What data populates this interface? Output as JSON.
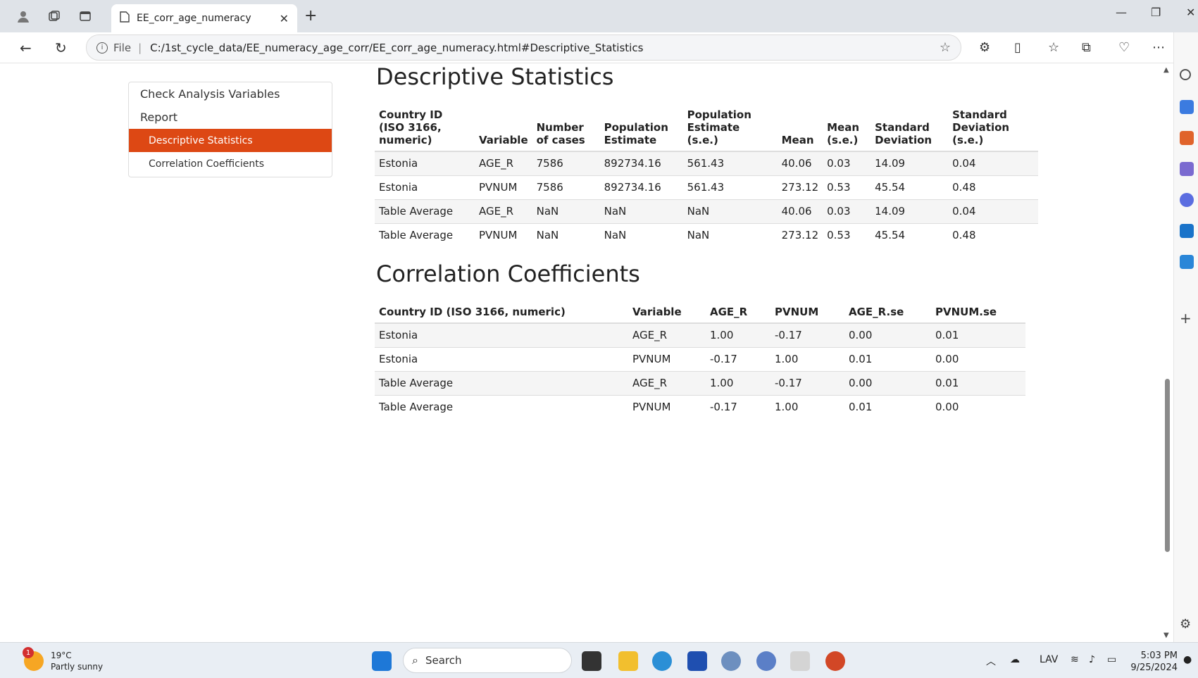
{
  "browser": {
    "tab_title": "EE_corr_age_numeracy",
    "address_prefix": "File",
    "url": "C:/1st_cycle_data/EE_numeracy_age_corr/EE_corr_age_numeracy.html#Descriptive_Statistics"
  },
  "toc": {
    "items": [
      {
        "label": "Check Analysis Variables"
      },
      {
        "label": "Report"
      },
      {
        "label": "Descriptive Statistics"
      },
      {
        "label": "Correlation Coefficients"
      }
    ]
  },
  "descriptive": {
    "heading": "Descriptive Statistics",
    "headers": [
      "Country ID (ISO 3166, numeric)",
      "Variable",
      "Number of cases",
      "Population Estimate",
      "Population Estimate (s.e.)",
      "Mean",
      "Mean (s.e.)",
      "Standard Deviation",
      "Standard Deviation (s.e.)"
    ],
    "rows": [
      [
        "Estonia",
        "AGE_R",
        "7586",
        "892734.16",
        "561.43",
        "40.06",
        "0.03",
        "14.09",
        "0.04"
      ],
      [
        "Estonia",
        "PVNUM",
        "7586",
        "892734.16",
        "561.43",
        "273.12",
        "0.53",
        "45.54",
        "0.48"
      ],
      [
        "Table Average",
        "AGE_R",
        "NaN",
        "NaN",
        "NaN",
        "40.06",
        "0.03",
        "14.09",
        "0.04"
      ],
      [
        "Table Average",
        "PVNUM",
        "NaN",
        "NaN",
        "NaN",
        "273.12",
        "0.53",
        "45.54",
        "0.48"
      ]
    ]
  },
  "correlation": {
    "heading": "Correlation Coefficients",
    "headers": [
      "Country ID (ISO 3166, numeric)",
      "Variable",
      "AGE_R",
      "PVNUM",
      "AGE_R.se",
      "PVNUM.se"
    ],
    "rows": [
      [
        "Estonia",
        "AGE_R",
        "1.00",
        "-0.17",
        "0.00",
        "0.01"
      ],
      [
        "Estonia",
        "PVNUM",
        "-0.17",
        "1.00",
        "0.01",
        "0.00"
      ],
      [
        "Table Average",
        "AGE_R",
        "1.00",
        "-0.17",
        "0.00",
        "0.01"
      ],
      [
        "Table Average",
        "PVNUM",
        "-0.17",
        "1.00",
        "0.01",
        "0.00"
      ]
    ]
  },
  "taskbar": {
    "weather_temp": "19°C",
    "weather_desc": "Partly sunny",
    "weather_badge": "1",
    "search_placeholder": "Search",
    "lang": "LAV",
    "time": "5:03 PM",
    "date": "9/25/2024"
  },
  "colors": {
    "accent": "#dd4814"
  }
}
